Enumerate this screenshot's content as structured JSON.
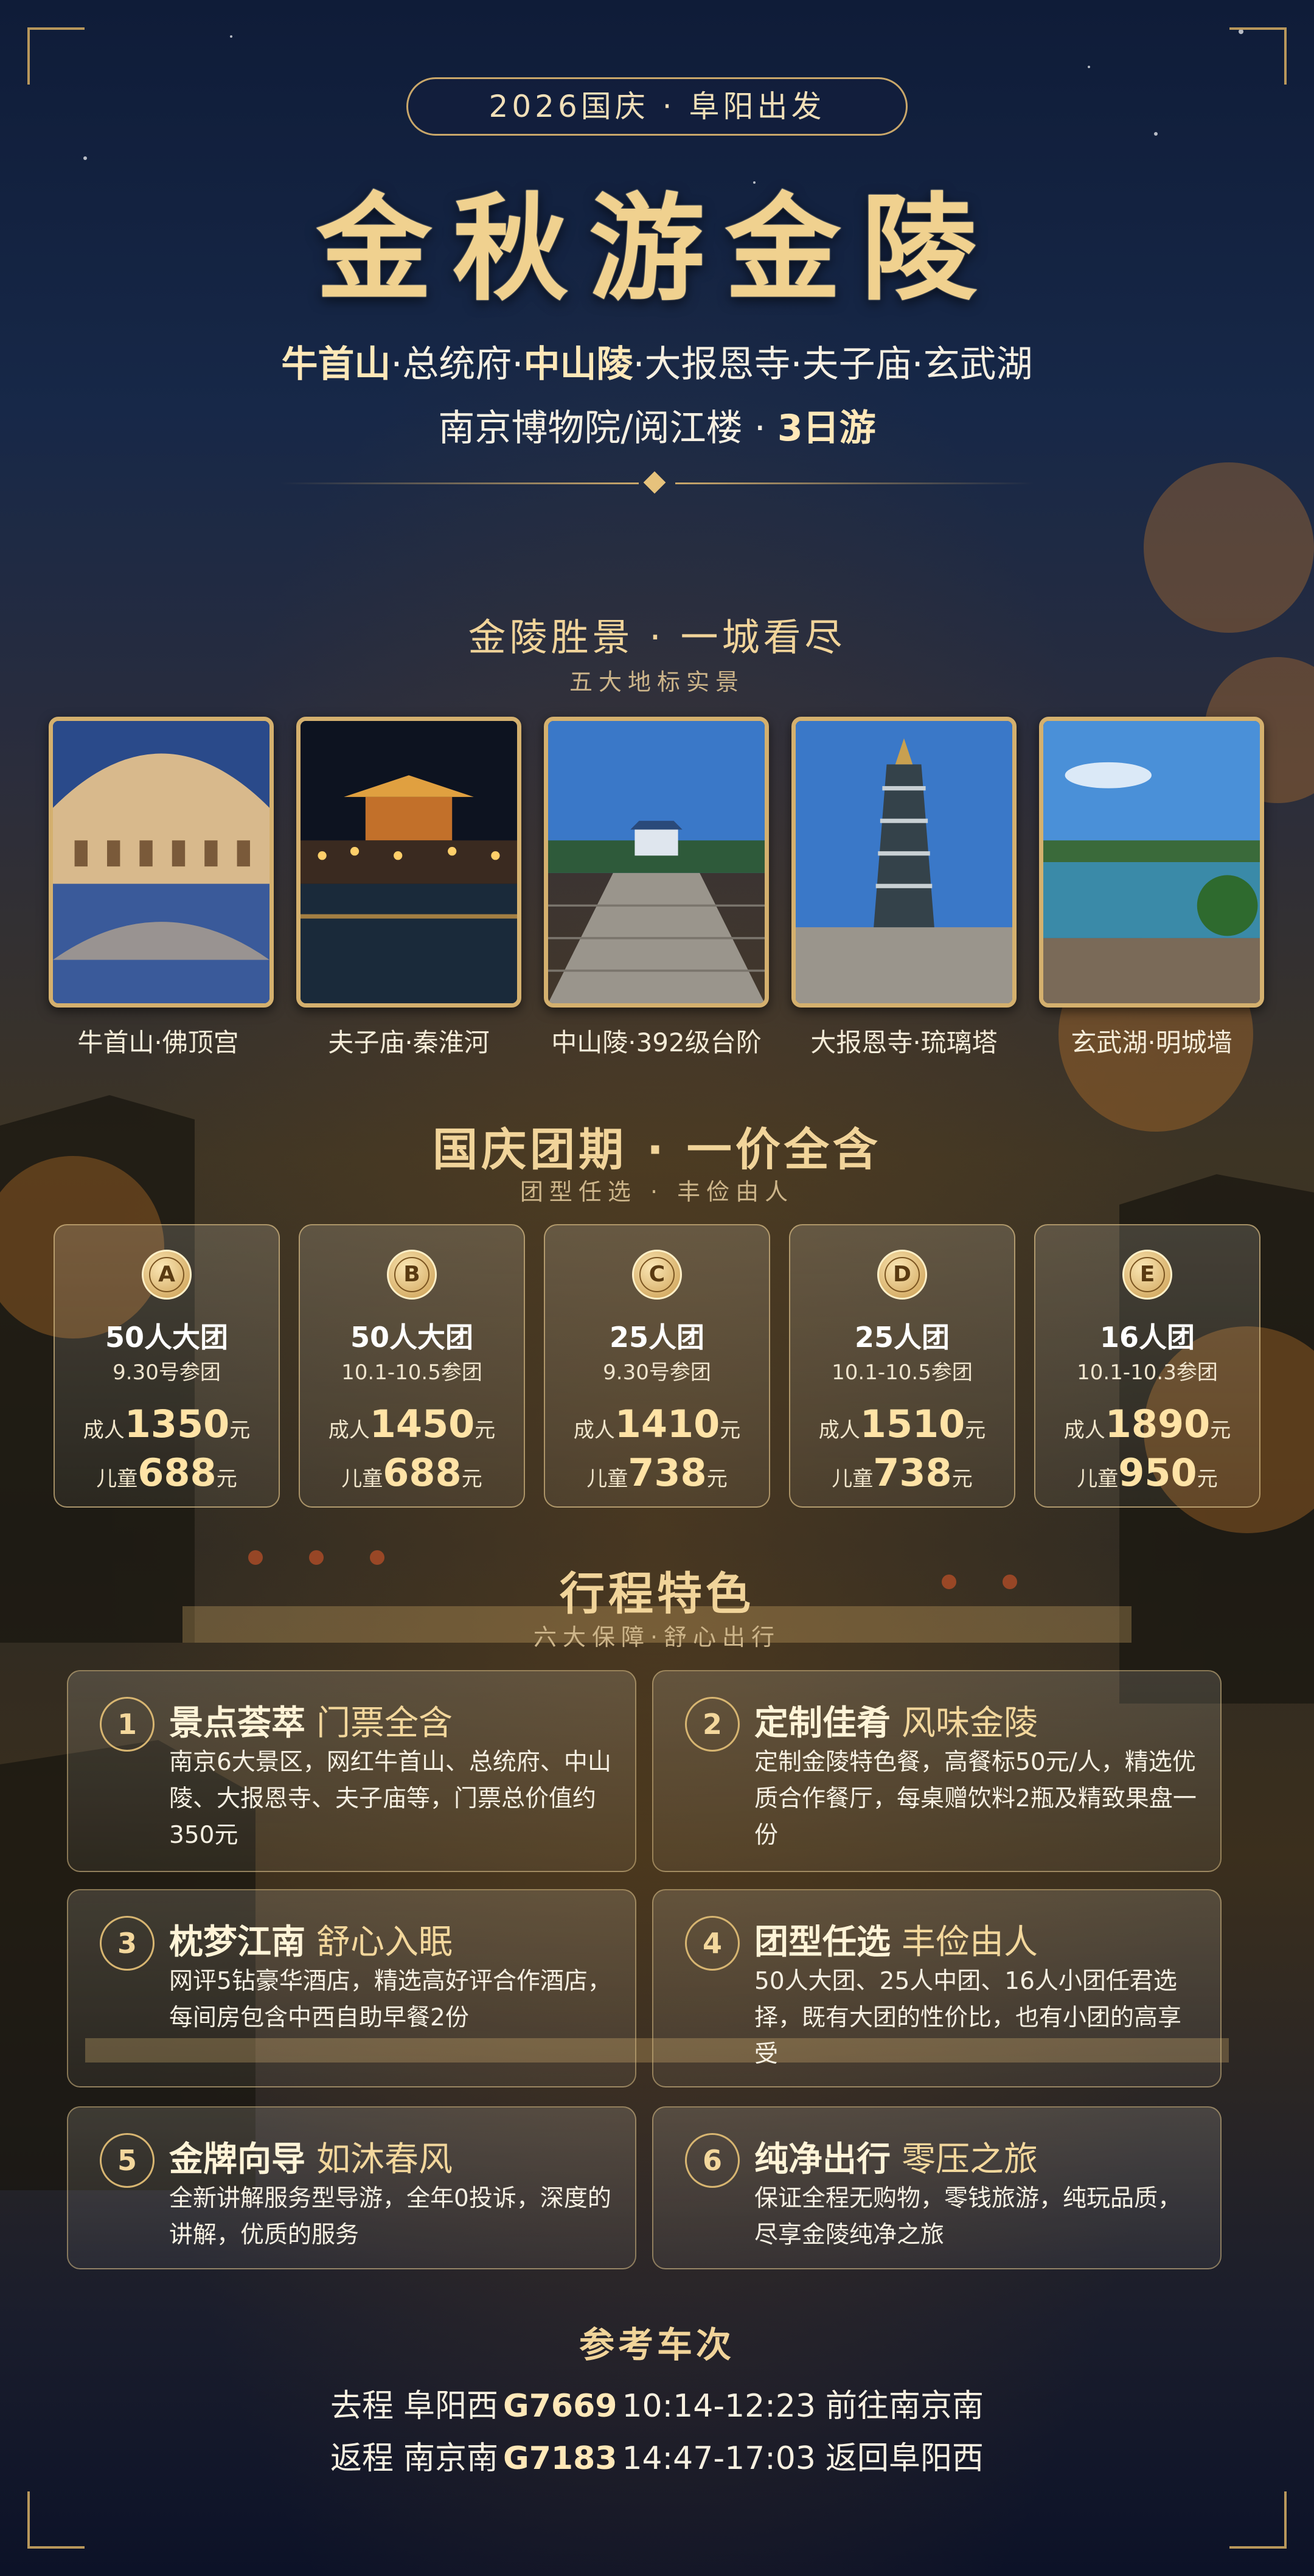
{
  "header": {
    "pill_text": "2026国庆 · 阜阳出发",
    "title": "金秋游金陵",
    "line1": {
      "a": "牛首山",
      "b": "·总统府·",
      "c": "中山陵",
      "d": "·大报恩寺·夫子庙·玄武湖"
    },
    "line2": {
      "a": "南京博物院/阅江楼 · ",
      "b": "3日游"
    }
  },
  "gallery": {
    "title": "金陵胜景 · 一城看尽",
    "subtitle": "五大地标实景",
    "items": [
      {
        "caption": "牛首山·佛顶宫"
      },
      {
        "caption": "夫子庙·秦淮河"
      },
      {
        "caption": "中山陵·392级台阶"
      },
      {
        "caption": "大报恩寺·琉璃塔"
      },
      {
        "caption": "玄武湖·明城墙"
      }
    ]
  },
  "tiers": {
    "title": "国庆团期 · 一价全含",
    "subtitle": "团型任选 · 丰俭由人",
    "adult_label": "成人",
    "child_label": "儿童",
    "unit": "元",
    "items": [
      {
        "badge": "A",
        "name": "50人大团",
        "date": "9.30号参团",
        "adult": "1350",
        "child": "688"
      },
      {
        "badge": "B",
        "name": "50人大团",
        "date": "10.1-10.5参团",
        "adult": "1450",
        "child": "688"
      },
      {
        "badge": "C",
        "name": "25人团",
        "date": "9.30号参团",
        "adult": "1410",
        "child": "738"
      },
      {
        "badge": "D",
        "name": "25人团",
        "date": "10.1-10.5参团",
        "adult": "1510",
        "child": "738"
      },
      {
        "badge": "E",
        "name": "16人团",
        "date": "10.1-10.3参团",
        "adult": "1890",
        "child": "950"
      }
    ]
  },
  "features": {
    "title": "行程特色",
    "subtitle": "六大保障·舒心出行",
    "items": [
      {
        "num": "1",
        "bold": "景点荟萃",
        "rest": "门票全含",
        "text": "南京6大景区，网红牛首山、总统府、中山陵、大报恩寺、夫子庙等，门票总价值约350元"
      },
      {
        "num": "2",
        "bold": "定制佳肴",
        "rest": "风味金陵",
        "text": "定制金陵特色餐，高餐标50元/人，精选优质合作餐厅，每桌赠饮料2瓶及精致果盘一份"
      },
      {
        "num": "3",
        "bold": "枕梦江南",
        "rest": "舒心入眠",
        "text": "网评5钻豪华酒店，精选高好评合作酒店，每间房包含中西自助早餐2份"
      },
      {
        "num": "4",
        "bold": "团型任选",
        "rest": "丰俭由人",
        "text": "50人大团、25人中团、16人小团任君选择，既有大团的性价比，也有小团的高享受"
      },
      {
        "num": "5",
        "bold": "金牌向导",
        "rest": "如沐春风",
        "text": "全新讲解服务型导游，全年0投诉，深度的讲解，优质的服务"
      },
      {
        "num": "6",
        "bold": "纯净出行",
        "rest": "零压之旅",
        "text": "保证全程无购物，零钱旅游，纯玩品质，尽享金陵纯净之旅"
      }
    ]
  },
  "trains": {
    "title": "参考车次",
    "go": {
      "label": "去程",
      "from": "阜阳西",
      "code": "G7669",
      "time": "10:14-12:23",
      "to": "前往南京南"
    },
    "back": {
      "label": "返程",
      "from": "南京南",
      "code": "G7183",
      "time": "14:47-17:03",
      "to": "返回阜阳西"
    }
  }
}
